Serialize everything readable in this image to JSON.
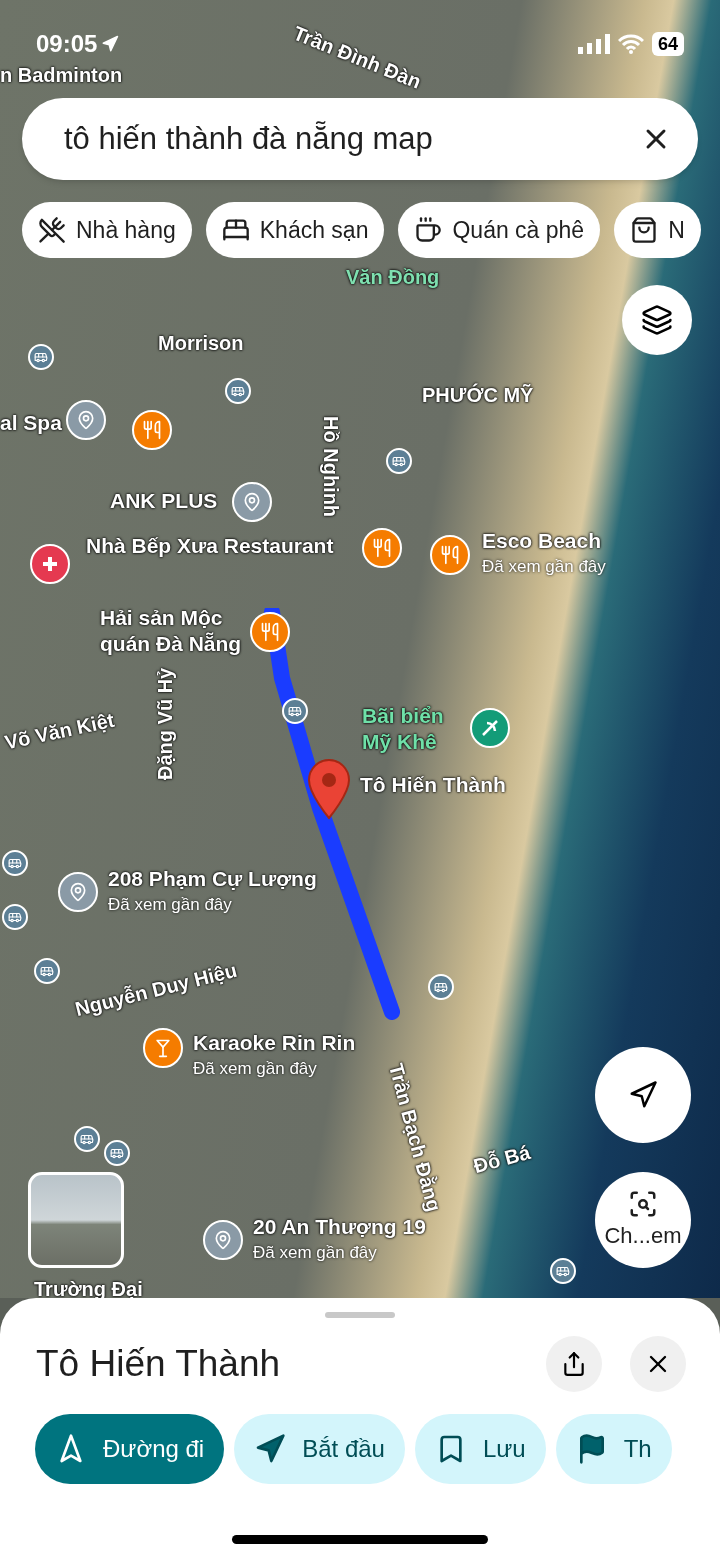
{
  "status_bar": {
    "time": "09:05",
    "battery": "64"
  },
  "search": {
    "value": "tô hiến thành đà nẵng map"
  },
  "chips": [
    {
      "kind": "restaurant",
      "label": "Nhà hàng"
    },
    {
      "kind": "hotel",
      "label": "Khách sạn"
    },
    {
      "kind": "cafe",
      "label": "Quán cà phê"
    },
    {
      "kind": "shopping",
      "label": "N"
    }
  ],
  "map": {
    "streets": [
      "Trần Đình Đàn",
      "Morrison",
      "PHƯỚC MỸ",
      "Hồ Nghinh",
      "Võ Văn Kiệt",
      "Đặng Vũ Hỷ",
      "Nguyễn Duy Hiệu",
      "Trần Bạch Đằng",
      "Đỗ Bá",
      "Văn Đồng",
      "n Badminton",
      "Trường Đại"
    ],
    "places": [
      {
        "kind": "pin",
        "name": "al Spa"
      },
      {
        "kind": "restaurant"
      },
      {
        "kind": "pin",
        "name": "ANK PLUS"
      },
      {
        "kind": "hospital"
      },
      {
        "kind": "restaurant",
        "name": "Nhà Bếp Xưa Restaurant"
      },
      {
        "kind": "restaurant",
        "name": "Esco Beach",
        "subtitle": "Đã xem gần đây"
      },
      {
        "kind": "restaurant",
        "name": "Hải sản Mộc quán Đà Nẵng"
      },
      {
        "kind": "beach",
        "name": "Bãi biển Mỹ Khê"
      },
      {
        "kind": "selected",
        "name": "Tô Hiến Thành"
      },
      {
        "kind": "pin",
        "name": "208 Phạm Cự Lượng",
        "subtitle": "Đã xem gần đây"
      },
      {
        "kind": "bar",
        "name": "Karaoke Rin Rin",
        "subtitle": "Đã xem gần đây"
      },
      {
        "kind": "pin",
        "name": "20 An Thượng 19",
        "subtitle": "Đã xem gần đây"
      }
    ],
    "lens_label": "Ch...em"
  },
  "sheet": {
    "title": "Tô Hiến Thành",
    "actions": [
      {
        "kind": "directions",
        "label": "Đường đi",
        "selected": true
      },
      {
        "kind": "start",
        "label": "Bắt đầu",
        "selected": false
      },
      {
        "kind": "save",
        "label": "Lưu",
        "selected": false
      },
      {
        "kind": "flag",
        "label": "Th",
        "selected": false
      }
    ]
  }
}
